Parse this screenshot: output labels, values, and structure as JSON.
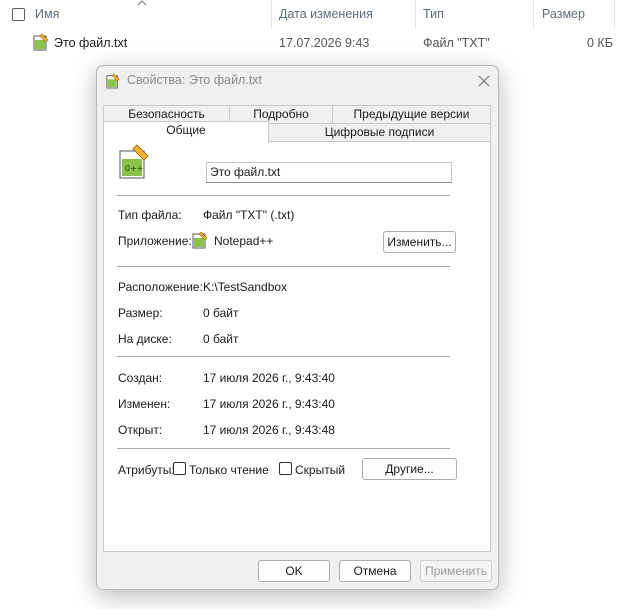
{
  "explorer": {
    "columns": [
      "Имя",
      "Дата изменения",
      "Тип",
      "Размер"
    ],
    "file": {
      "name": "Это файл.txt",
      "date": "17.07.2026 9:43",
      "type": "Файл \"TXT\"",
      "size": "0 КБ"
    }
  },
  "dialog": {
    "title": "Свойства: Это файл.txt",
    "tabs_top": [
      "Безопасность",
      "Подробно",
      "Предыдущие версии"
    ],
    "tabs_bottom": [
      "Общие",
      "Цифровые подписи"
    ],
    "filename": "Это файл.txt",
    "file_type_label": "Тип файла:",
    "file_type_value": "Файл \"TXT\" (.txt)",
    "app_label": "Приложение:",
    "app_value": "Notepad++",
    "change_button": "Изменить...",
    "location_label": "Расположение:",
    "location_value": "K:\\TestSandbox",
    "size_label": "Размер:",
    "size_value": "0 байт",
    "disk_label": "На диске:",
    "disk_value": "0 байт",
    "created_label": "Создан:",
    "created_value": "17 июля 2026 г., 9:43:40",
    "modified_label": "Изменен:",
    "modified_value": "17 июля 2026 г., 9:43:40",
    "accessed_label": "Открыт:",
    "accessed_value": "17 июля 2026 г., 9:43:48",
    "attributes_label": "Атрибуты:",
    "readonly_label": "Только чтение",
    "hidden_label": "Скрытый",
    "other_button": "Другие...",
    "ok_button": "OK",
    "cancel_button": "Отмена",
    "apply_button": "Применить"
  }
}
